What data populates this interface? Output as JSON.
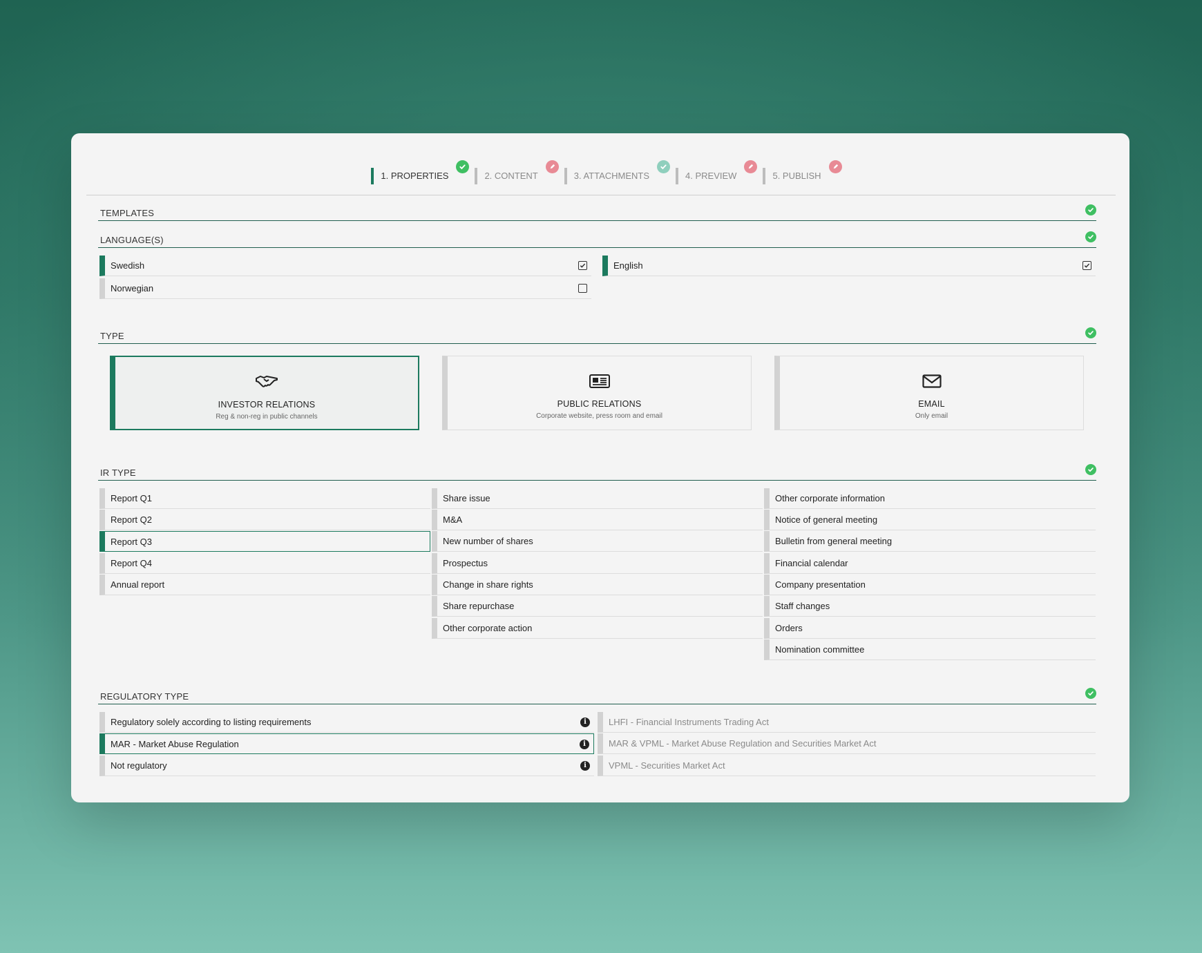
{
  "colors": {
    "accent": "#1c7a5e",
    "ok": "#3fbf62",
    "edit": "#e88a95"
  },
  "steps": [
    {
      "label": "1. PROPERTIES",
      "status": "ok"
    },
    {
      "label": "2. CONTENT",
      "status": "edit"
    },
    {
      "label": "3. ATTACHMENTS",
      "status": "ok-muted"
    },
    {
      "label": "4. PREVIEW",
      "status": "edit"
    },
    {
      "label": "5. PUBLISH",
      "status": "edit"
    }
  ],
  "sections": {
    "templates": "TEMPLATES",
    "languages": "LANGUAGE(S)",
    "type": "TYPE",
    "ir_type": "IR TYPE",
    "regulatory_type": "REGULATORY TYPE"
  },
  "languages": [
    {
      "label": "Swedish",
      "checked": true
    },
    {
      "label": "Norwegian",
      "checked": false
    },
    {
      "label": "English",
      "checked": true
    }
  ],
  "types": [
    {
      "title": "INVESTOR RELATIONS",
      "subtitle": "Reg & non-reg in public channels",
      "icon": "handshake-icon",
      "selected": true
    },
    {
      "title": "PUBLIC RELATIONS",
      "subtitle": "Corporate website, press room and email",
      "icon": "newspaper-icon",
      "selected": false
    },
    {
      "title": "EMAIL",
      "subtitle": "Only email",
      "icon": "envelope-icon",
      "selected": false
    }
  ],
  "ir_types": {
    "col1": [
      "Report Q1",
      "Report Q2",
      "Report Q3",
      "Report Q4",
      "Annual report"
    ],
    "col2": [
      "Share issue",
      "M&A",
      "New number of shares",
      "Prospectus",
      "Change in share rights",
      "Share repurchase",
      "Other corporate action"
    ],
    "col3": [
      "Other corporate information",
      "Notice of general meeting",
      "Bulletin from general meeting",
      "Financial calendar",
      "Company presentation",
      "Staff changes",
      "Orders",
      "Nomination committee"
    ],
    "selected": "Report Q3"
  },
  "regulatory": {
    "left": [
      "Regulatory solely according to listing requirements",
      "MAR - Market Abuse Regulation",
      "Not regulatory"
    ],
    "right": [
      "LHFI - Financial Instruments Trading Act",
      "MAR & VPML - Market Abuse Regulation and Securities Market Act",
      "VPML - Securities Market Act"
    ],
    "selected": "MAR - Market Abuse Regulation",
    "info_icon": "i"
  }
}
